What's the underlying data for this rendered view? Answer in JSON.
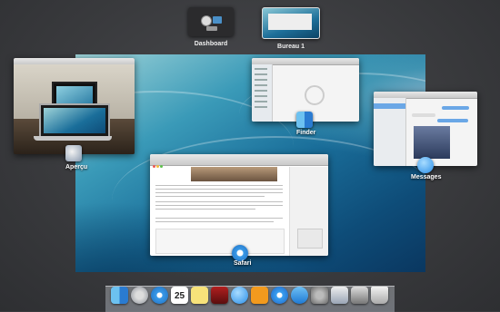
{
  "spaces": {
    "dashboard_label": "Dashboard",
    "desktop_label": "Bureau 1"
  },
  "windows": {
    "apercu_label": "Aperçu",
    "finder_label": "Finder",
    "messages_label": "Messages",
    "safari_label": "Safari"
  },
  "icons": {
    "apercu": "preview-app-icon",
    "finder": "finder-app-icon",
    "messages": "messages-app-icon",
    "safari": "safari-app-icon"
  },
  "dock": {
    "items": [
      "finder",
      "launchpad",
      "safari",
      "calendar",
      "notes",
      "photo-booth",
      "messages",
      "ibooks",
      "itunes",
      "app-store",
      "system-preferences",
      "preview",
      "migration",
      "trash"
    ],
    "calendar_day": "25"
  }
}
